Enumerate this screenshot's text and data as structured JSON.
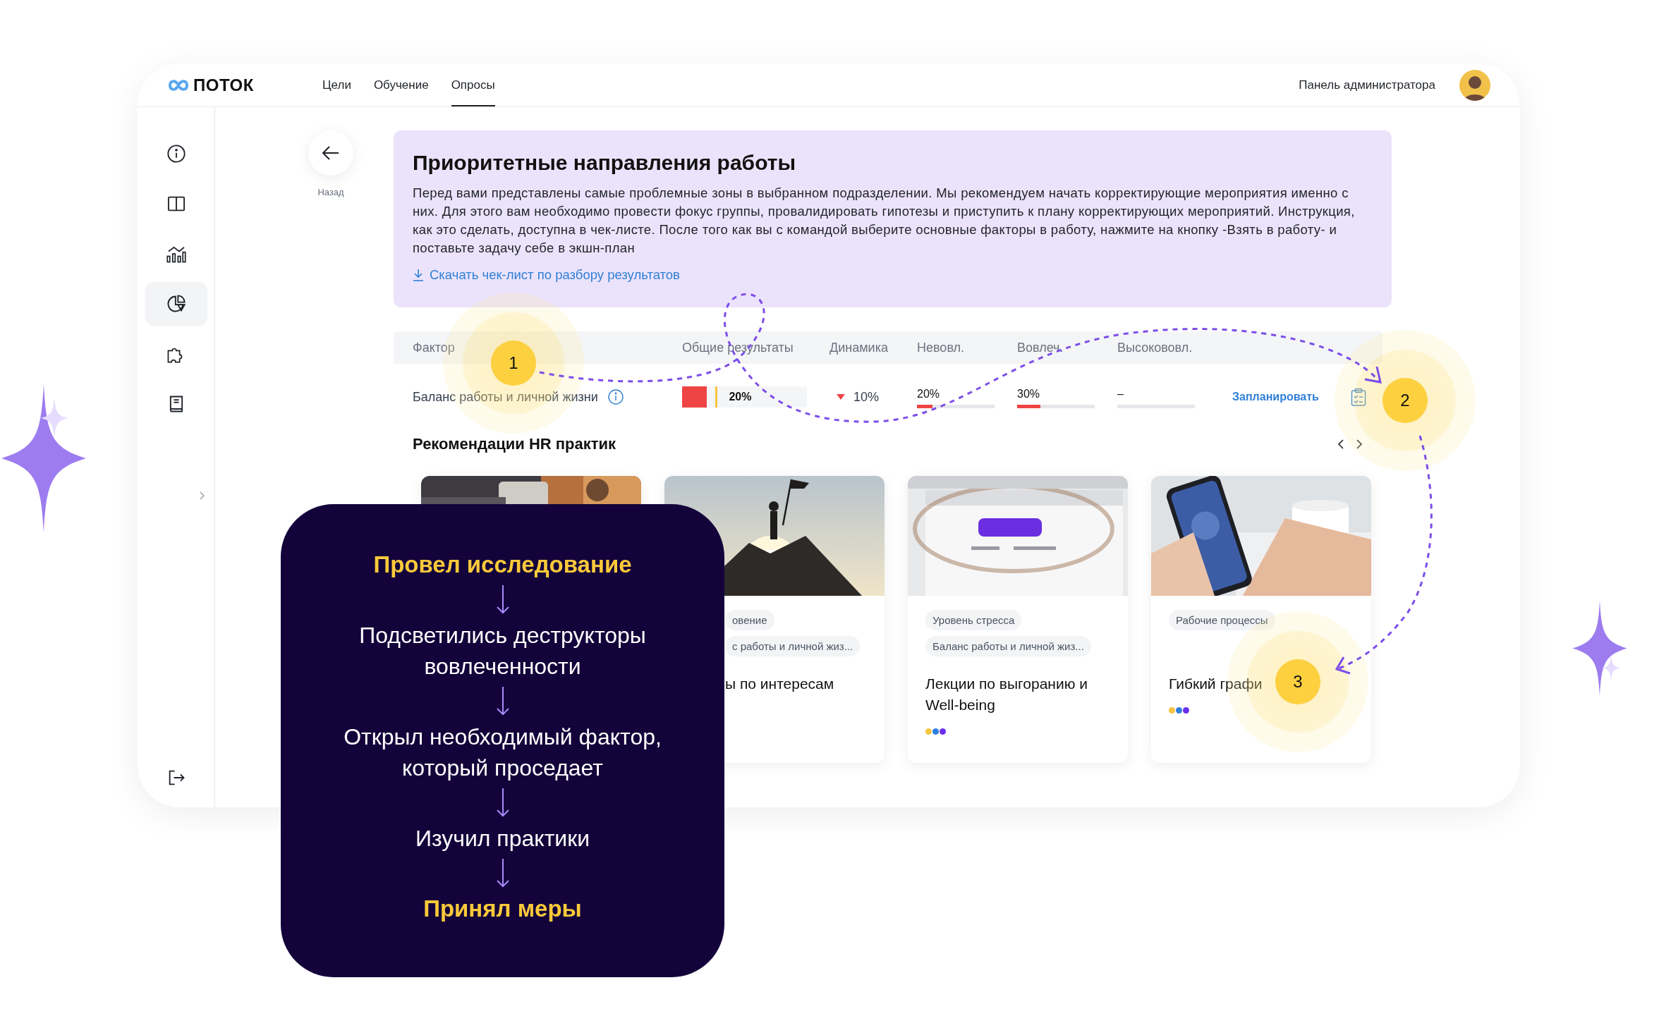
{
  "app": {
    "logo": "ПОТОК"
  },
  "nav": [
    {
      "label": "Цели",
      "selected": false
    },
    {
      "label": "Обучение",
      "selected": false
    },
    {
      "label": "Опросы",
      "selected": true
    }
  ],
  "admin_link": "Панель администратора",
  "sidebar": {
    "items": [
      {
        "kind": "info",
        "selected": false
      },
      {
        "kind": "layout",
        "selected": false
      },
      {
        "kind": "chart",
        "selected": false
      },
      {
        "kind": "pie",
        "selected": true
      },
      {
        "kind": "puzzle",
        "selected": false
      },
      {
        "kind": "book",
        "selected": false
      }
    ]
  },
  "back": {
    "label": "Назад"
  },
  "panel": {
    "title": "Приоритетные направления работы",
    "text": "Перед вами представлены самые проблемные зоны в выбранном подразделении. Мы рекомендуем начать корректирующие мероприятия именно с них. Для этого вам необходимо провести фокус группы, провалидировать гипотезы и приступить к плану корректирующих мероприятий. Инструкция, как это сделать, доступна в чек-листе. После того как вы с командой выберите основные факторы в работу, нажмите на кнопку -Взять в работу- и поставьте задачу себе в экшн-план",
    "link": "Скачать чек-лист по разбору результатов"
  },
  "table": {
    "columns": [
      "Фактор",
      "Общие результаты",
      "Динамика",
      "Невовл.",
      "Вовлеч.",
      "Высокововл."
    ],
    "rows": [
      {
        "factor": "Баланс работы и личной жизни",
        "total": {
          "value": "20%",
          "level": 0.2
        },
        "trend_down": true,
        "change": "10%",
        "unengaged": {
          "value": "20%",
          "level": 0.2
        },
        "engaged": {
          "value": "30%",
          "level": 0.3
        },
        "highly_engaged": {
          "value": "–",
          "level": 0
        },
        "action": "Запланировать"
      }
    ]
  },
  "recommendations": {
    "title": "Рекомендации HR практик",
    "cards": [
      {
        "kind": "covered"
      },
      {
        "kind": "covered",
        "tags": [
          "овение",
          "с работы и личной жиз..."
        ],
        "title": "ы по интересам"
      },
      {
        "kind": "plain",
        "tags": [
          "Уровень стресса",
          "Баланс работы и личной жиз..."
        ],
        "title": "Лекции по выгоранию и Well-being",
        "dots": [
          {
            "color": "#f5c542"
          },
          {
            "color": "#2f7fe0"
          },
          {
            "color": "#6b2ff0"
          }
        ]
      },
      {
        "kind": "plain",
        "tags": [
          "Рабочие процессы"
        ],
        "title": "Гибкий графи",
        "dots": [
          {
            "color": "#f5c542"
          },
          {
            "color": "#2f7fe0"
          },
          {
            "color": "#6b2ff0"
          }
        ]
      }
    ]
  },
  "steps": [
    {
      "kind": "highlight",
      "text": "Провел исследование"
    },
    {
      "kind": "plain",
      "text": "Подсветились деструкторы вовлеченности"
    },
    {
      "kind": "plain",
      "text": "Открыл необходимый фактор, который проседает"
    },
    {
      "kind": "plain",
      "text": "Изучил практики"
    },
    {
      "kind": "highlight",
      "text": "Принял меры"
    }
  ],
  "markers": [
    "1",
    "2",
    "3"
  ]
}
